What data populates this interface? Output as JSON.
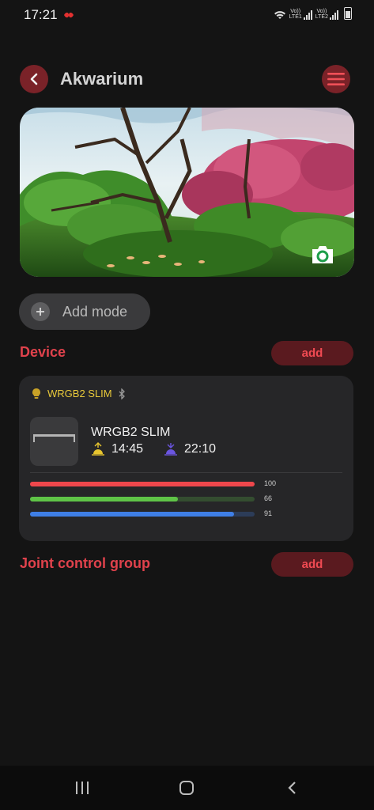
{
  "status": {
    "time": "17:21",
    "sim1": "LTE1",
    "sim2": "LTE2",
    "volte": "Vo))"
  },
  "header": {
    "title": "Akwarium"
  },
  "add_mode": {
    "label": "Add mode"
  },
  "device_section": {
    "title": "Device",
    "add_label": "add"
  },
  "device": {
    "name": "WRGB2 SLIM",
    "title": "WRGB2 SLIM",
    "sunrise": "14:45",
    "sunset": "22:10",
    "channels": [
      {
        "color": "#ef474c",
        "value": 100,
        "label": "100"
      },
      {
        "color": "#5fc447",
        "value": 66,
        "label": "66"
      },
      {
        "color": "#3f7fe6",
        "value": 91,
        "label": "91"
      }
    ]
  },
  "group_section": {
    "title": "Joint control group",
    "add_label": "add"
  },
  "icons": {
    "back": "chevron-left-icon",
    "menu": "hamburger-icon",
    "camera": "camera-icon",
    "plus": "plus-icon",
    "bulb": "bulb-icon",
    "bluetooth": "bluetooth-icon",
    "sunrise": "sunrise-icon",
    "sunset": "sunset-icon"
  },
  "colors": {
    "accent": "#e0424c",
    "button_bg": "#5a1a1f",
    "card_bg": "#262628"
  }
}
